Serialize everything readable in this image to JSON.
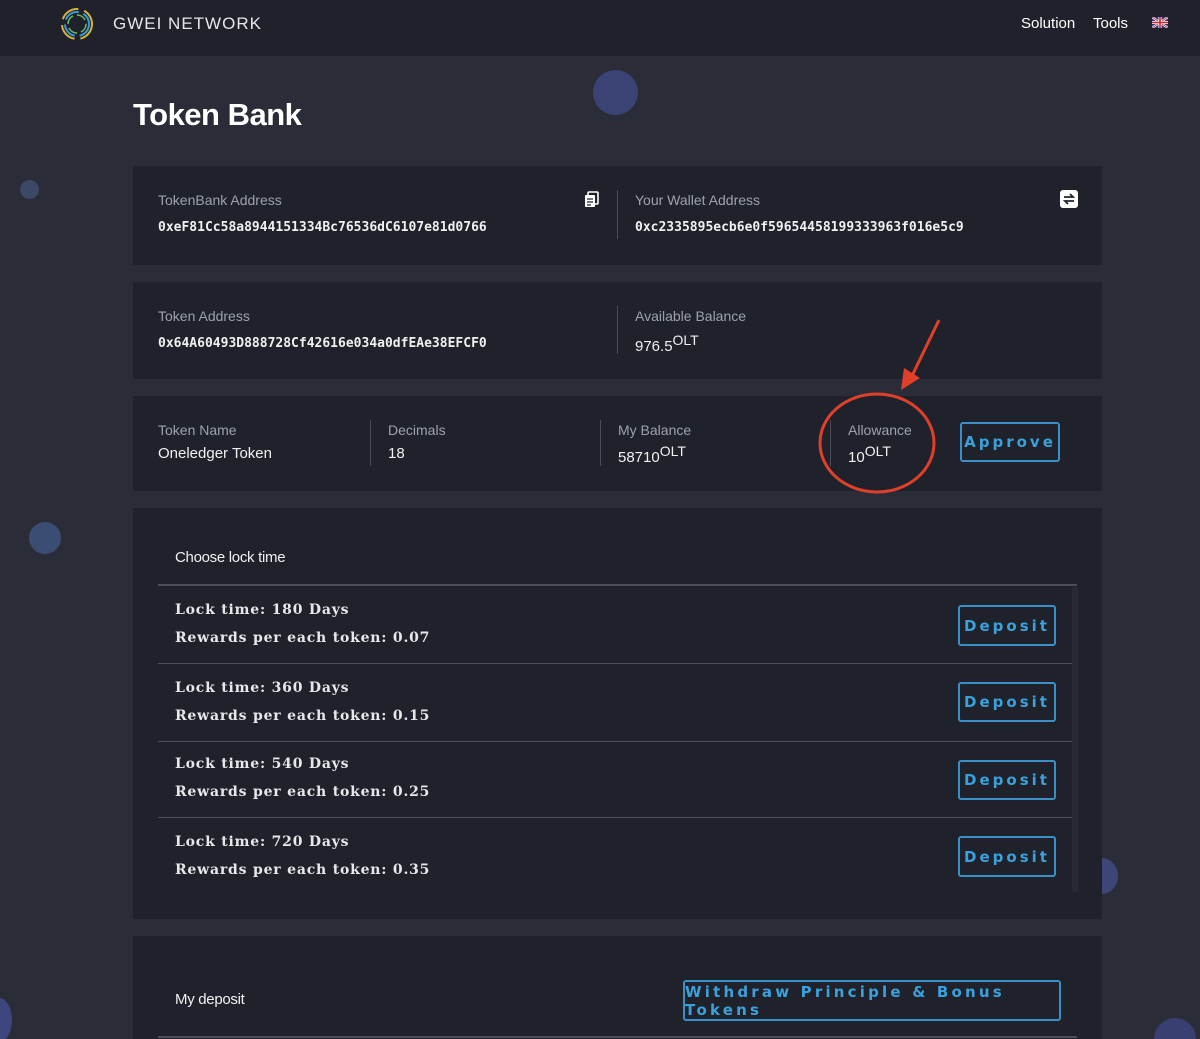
{
  "header": {
    "brand": "GWEI NETWORK",
    "nav": [
      "Solution",
      "Tools"
    ],
    "flag_icon": "uk-flag-icon"
  },
  "page": {
    "title": "Token Bank"
  },
  "addresses": {
    "tokenbank_label": "TokenBank Address",
    "tokenbank_value": "0xeF81Cc58a8944151334Bc76536dC6107e81d0766",
    "wallet_label": "Your Wallet Address",
    "wallet_value": "0xc2335895ecb6e0f59654458199333963f016e5c9",
    "copy_icon": "copy-icon",
    "switch_icon": "swap-icon"
  },
  "token": {
    "address_label": "Token Address",
    "address_value": "0x64A60493D888728Cf42616e034a0dfEAe38EFCF0",
    "available_label": "Available Balance",
    "available_value": "976.5",
    "available_unit": "OLT"
  },
  "info": {
    "name_label": "Token Name",
    "name_value": "Oneledger Token",
    "decimals_label": "Decimals",
    "decimals_value": "18",
    "balance_label": "My Balance",
    "balance_value": "58710",
    "balance_unit": "OLT",
    "allowance_label": "Allowance",
    "allowance_value": "10",
    "allowance_unit": "OLT",
    "approve_label": "Approve"
  },
  "lock": {
    "title": "Choose lock time",
    "rows": [
      {
        "time": "Lock time: 180 Days",
        "reward": "Rewards per each token: 0.07",
        "button": "Deposit"
      },
      {
        "time": "Lock time: 360 Days",
        "reward": "Rewards per each token: 0.15",
        "button": "Deposit"
      },
      {
        "time": "Lock time: 540 Days",
        "reward": "Rewards per each token: 0.25",
        "button": "Deposit"
      },
      {
        "time": "Lock time: 720 Days",
        "reward": "Rewards per each token: 0.35",
        "button": "Deposit"
      }
    ]
  },
  "deposit": {
    "title": "My deposit",
    "withdraw_label": "Withdraw Principle & Bonus Tokens"
  },
  "colors": {
    "background": "#2a2d38",
    "card": "#1f222b",
    "accent": "#3aa1dc",
    "annotation": "#e0402a"
  }
}
